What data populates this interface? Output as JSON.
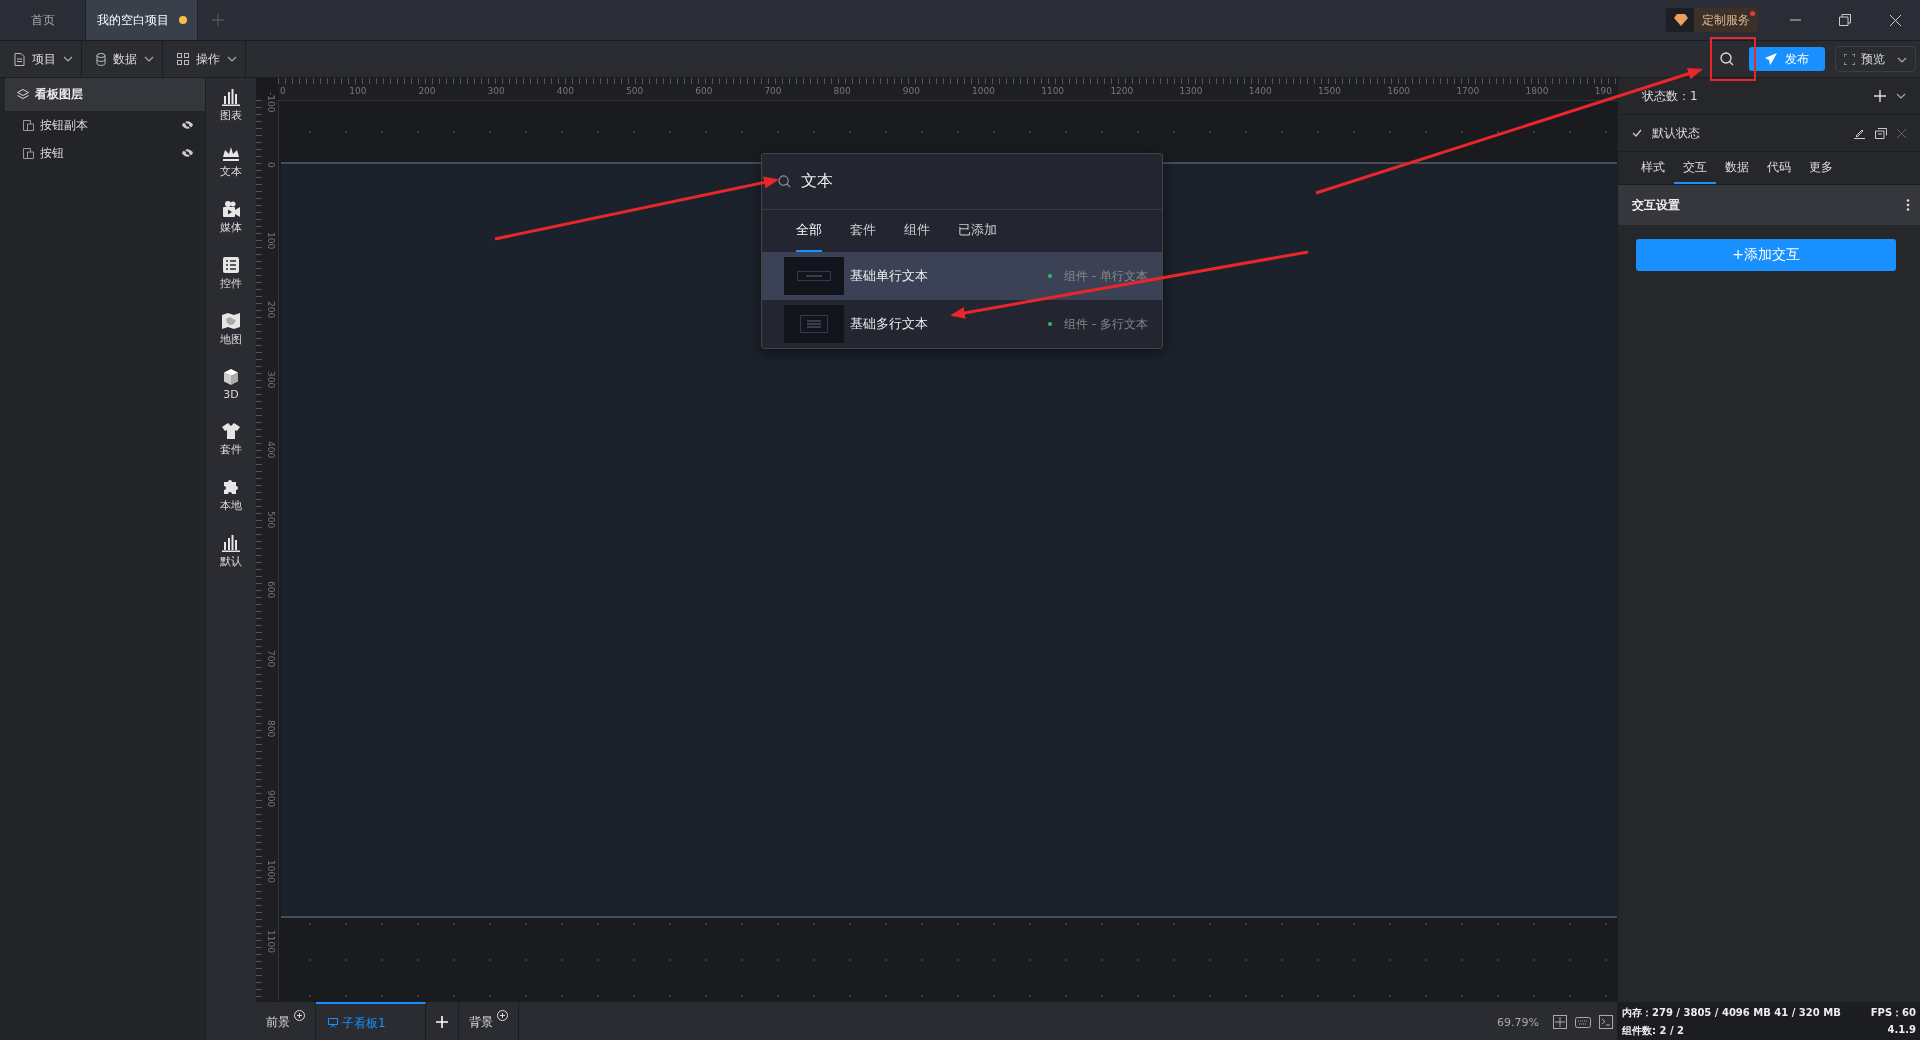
{
  "title_bar": {
    "tabs": [
      {
        "label": "首页",
        "selected": false,
        "unsaved": false
      },
      {
        "label": "我的空白项目",
        "selected": true,
        "unsaved": true
      }
    ],
    "service_button": {
      "label": "定制服务",
      "notice": true
    }
  },
  "toolbar": {
    "menus": [
      {
        "label": "项目",
        "kind": "file"
      },
      {
        "label": "数据",
        "kind": "database"
      },
      {
        "label": "操作",
        "kind": "grid"
      }
    ],
    "publish": "发布",
    "preview": "预览"
  },
  "layers": {
    "title": "看板图层",
    "items": [
      {
        "name": "按钮副本",
        "hidden": true
      },
      {
        "name": "按钮",
        "hidden": true
      }
    ]
  },
  "tools": [
    {
      "label": "图表",
      "kind": "chart"
    },
    {
      "label": "文本",
      "kind": "crown"
    },
    {
      "label": "媒体",
      "kind": "camera"
    },
    {
      "label": "控件",
      "kind": "list"
    },
    {
      "label": "地图",
      "kind": "map"
    },
    {
      "label": "3D",
      "kind": "cube"
    },
    {
      "label": "套件",
      "kind": "shirt"
    },
    {
      "label": "本地",
      "kind": "puzzle"
    },
    {
      "label": "默认",
      "kind": "chart"
    }
  ],
  "rulers": {
    "horizontal": [
      "0",
      "100",
      "200",
      "300",
      "400",
      "500",
      "600",
      "700",
      "800",
      "900",
      "1000",
      "1100",
      "1200",
      "1300",
      "1400",
      "1500",
      "1600",
      "1700",
      "1800",
      "190"
    ],
    "vertical": [
      "-100",
      "0",
      "100",
      "200",
      "300",
      "400",
      "500",
      "600",
      "700",
      "800",
      "900",
      "1000",
      "1100"
    ]
  },
  "search_popup": {
    "query": "文本",
    "tabs": [
      {
        "label": "全部",
        "selected": true
      },
      {
        "label": "套件",
        "selected": false
      },
      {
        "label": "组件",
        "selected": false
      },
      {
        "label": "已添加",
        "selected": false
      }
    ],
    "results": [
      {
        "title": "基础单行文本",
        "category": "组件 - 单行文本",
        "selected": true,
        "kind": "single"
      },
      {
        "title": "基础多行文本",
        "category": "组件 - 多行文本",
        "selected": false,
        "kind": "multi"
      }
    ]
  },
  "right_panel": {
    "state_count": "状态数：1",
    "state": {
      "name": "默认状态",
      "checked": true
    },
    "tabs": [
      {
        "label": "样式",
        "selected": false
      },
      {
        "label": "交互",
        "selected": true
      },
      {
        "label": "数据",
        "selected": false
      },
      {
        "label": "代码",
        "selected": false
      },
      {
        "label": "更多",
        "selected": false
      }
    ],
    "section": "交互设置",
    "add_button": "+添加交互"
  },
  "bottom_bar": {
    "foreground": "前景",
    "boards": [
      {
        "label": "子看板1",
        "selected": true
      }
    ],
    "background": "背景",
    "zoom": "69.79%"
  },
  "status": {
    "memory": "内存：279 / 3805 / 4096 MB  41 / 320 MB",
    "fps": "FPS：60",
    "components": "组件数: 2 / 2",
    "version": "4.1.9"
  }
}
